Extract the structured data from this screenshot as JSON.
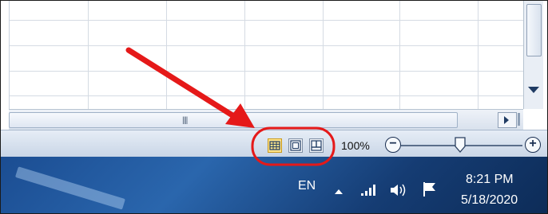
{
  "status_bar": {
    "view_modes": [
      {
        "name": "Normal",
        "icon": "normal-view-icon",
        "active": true
      },
      {
        "name": "Page Layout",
        "icon": "page-layout-view-icon",
        "active": false
      },
      {
        "name": "Page Break Preview",
        "icon": "page-break-preview-icon",
        "active": false
      }
    ],
    "zoom_level": "100%",
    "zoom_out_symbol": "−",
    "zoom_in_symbol": "+",
    "zoom_slider_fraction": 0.5
  },
  "taskbar": {
    "language": "EN",
    "tray_icons": [
      "show-hidden-icons-arrow",
      "network-signal-icon",
      "volume-icon",
      "action-center-flag-icon"
    ],
    "clock_time": "8:21 PM",
    "clock_date": "5/18/2020"
  },
  "annotation": {
    "arrow_color": "#e51919",
    "highlight_color": "#e51919"
  }
}
